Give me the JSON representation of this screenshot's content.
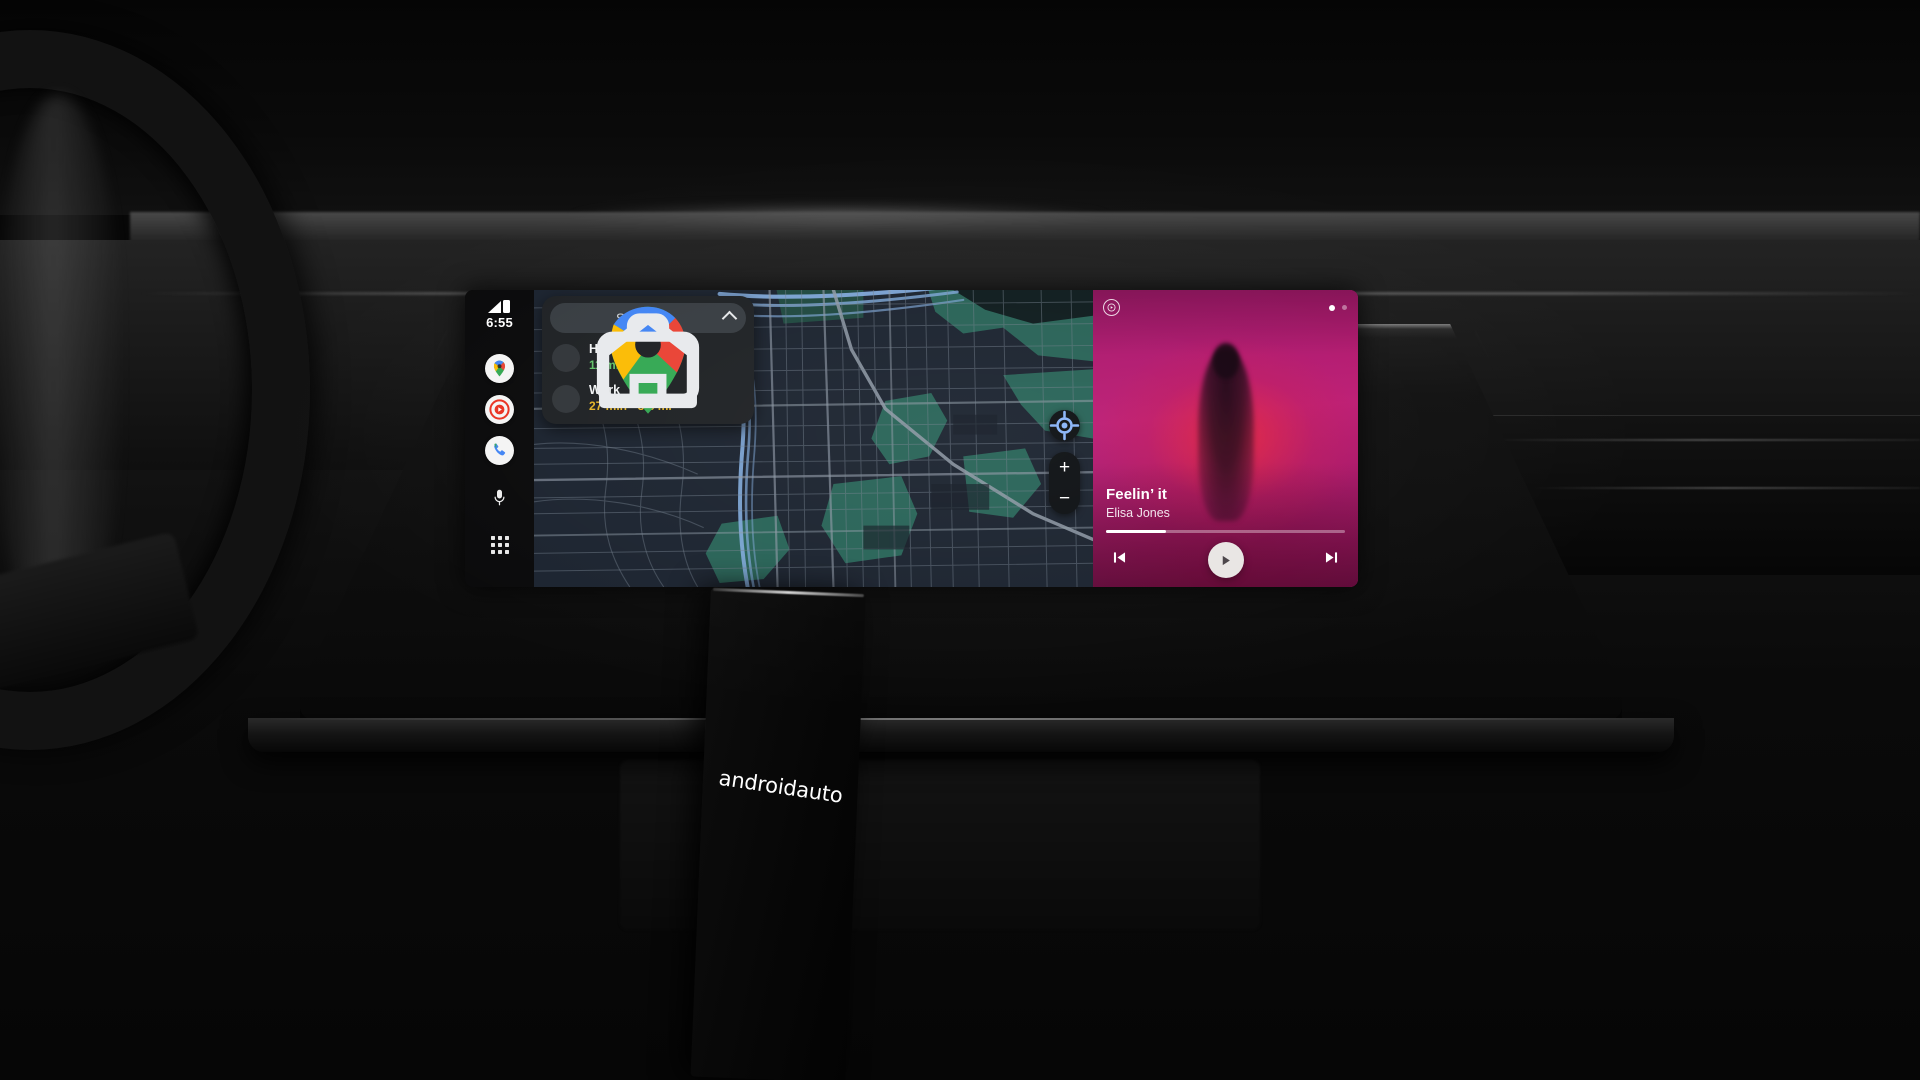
{
  "scene": {
    "environment": "car-interior-dashboard",
    "brand_placard": {
      "text_android": "android",
      "text_auto": "auto",
      "full": "androidauto"
    }
  },
  "statusbar": {
    "time": "6:55",
    "signal_icon": "signal-bars-icon",
    "battery_icon": "battery-icon"
  },
  "sidebar": {
    "apps": [
      {
        "name": "google-maps",
        "label": "Maps",
        "icon": "maps-pin-icon"
      },
      {
        "name": "youtube-music",
        "label": "YouTube Music",
        "icon": "youtube-music-icon"
      },
      {
        "name": "phone",
        "label": "Phone",
        "icon": "phone-icon"
      }
    ],
    "system": [
      {
        "name": "assistant-mic",
        "label": "Assistant",
        "icon": "microphone-icon"
      },
      {
        "name": "app-launcher",
        "label": "All apps",
        "icon": "grid-apps-icon"
      }
    ]
  },
  "maps": {
    "search": {
      "placeholder": "Search",
      "label": "Search",
      "leading_icon": "maps-pin-icon",
      "trailing_icon": "chevron-up-icon"
    },
    "destinations": [
      {
        "id": "home",
        "title": "Home",
        "eta": "11 min · 4.2 mi",
        "icon": "home-icon",
        "eta_color": "#63c36a"
      },
      {
        "id": "work",
        "title": "Work",
        "eta": "27 min · 8.3 mi",
        "icon": "briefcase-icon",
        "eta_color": "#e3b528"
      }
    ],
    "controls": {
      "locate": {
        "name": "my-location-button",
        "icon": "crosshair-icon"
      },
      "zoom_in": {
        "name": "zoom-in-button",
        "label": "+"
      },
      "zoom_out": {
        "name": "zoom-out-button",
        "label": "−"
      }
    },
    "colors": {
      "land": "#1c2430",
      "park": "#2b6a5c",
      "road": "#8f9aa6",
      "water": "#7fa8d8",
      "card": "#1f2225"
    }
  },
  "media": {
    "app_icon": "youtube-music-icon",
    "page_dots": {
      "total": 2,
      "active_index": 0
    },
    "track_title": "Feelin’ it",
    "artist": "Elisa Jones",
    "progress_percent": 25,
    "accent_color": "#bb1a72",
    "controls": {
      "previous": {
        "name": "previous-track-button",
        "icon": "skip-previous-icon"
      },
      "play": {
        "name": "play-button",
        "icon": "play-icon"
      },
      "next": {
        "name": "next-track-button",
        "icon": "skip-next-icon"
      }
    }
  }
}
